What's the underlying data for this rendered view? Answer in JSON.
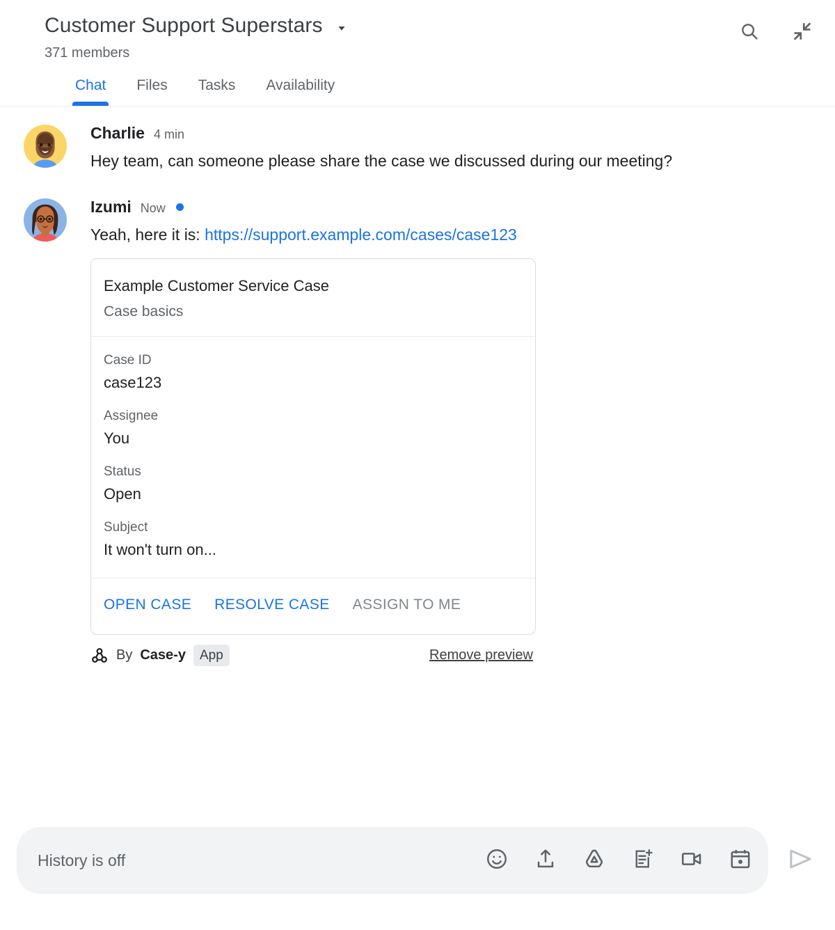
{
  "header": {
    "room_title": "Customer Support Superstars",
    "members": "371 members",
    "dropdown_icon": "chevron-down-icon",
    "search_icon": "search-icon",
    "collapse_icon": "collapse-icon"
  },
  "tabs": [
    {
      "label": "Chat",
      "active": true
    },
    {
      "label": "Files",
      "active": false
    },
    {
      "label": "Tasks",
      "active": false
    },
    {
      "label": "Availability",
      "active": false
    }
  ],
  "messages": [
    {
      "sender": "Charlie",
      "timestamp": "4 min",
      "unread": false,
      "text": "Hey team, can someone please share the case we discussed during our meeting?",
      "avatar": "avatar-charlie"
    },
    {
      "sender": "Izumi",
      "timestamp": "Now",
      "unread": true,
      "text_before_link": "Yeah, here it is: ",
      "link_text": "https://support.example.com/cases/case123",
      "avatar": "avatar-izumi"
    }
  ],
  "card": {
    "title": "Example Customer Service Case",
    "subtitle": "Case basics",
    "fields": [
      {
        "label": "Case ID",
        "value": "case123"
      },
      {
        "label": "Assignee",
        "value": "You"
      },
      {
        "label": "Status",
        "value": "Open"
      },
      {
        "label": "Subject",
        "value": "It won't turn on..."
      }
    ],
    "actions": [
      {
        "label": "OPEN CASE",
        "disabled": false
      },
      {
        "label": "RESOLVE CASE",
        "disabled": false
      },
      {
        "label": "ASSIGN TO ME",
        "disabled": true
      }
    ],
    "footer": {
      "app_icon": "webhook-icon",
      "by_text": "By",
      "app_name": "Case-y",
      "app_badge": "App",
      "remove_preview": "Remove preview"
    }
  },
  "compose": {
    "placeholder": "History is off",
    "icons": [
      "emoji-icon",
      "upload-icon",
      "google-drive-icon",
      "add-document-icon",
      "video-camera-icon",
      "calendar-icon"
    ],
    "send_icon": "send-icon"
  },
  "colors": {
    "accent": "#1a73e8",
    "text_primary": "#202124",
    "text_secondary": "#5f6368",
    "border": "#dadce0",
    "compose_bg": "#f1f3f4"
  }
}
